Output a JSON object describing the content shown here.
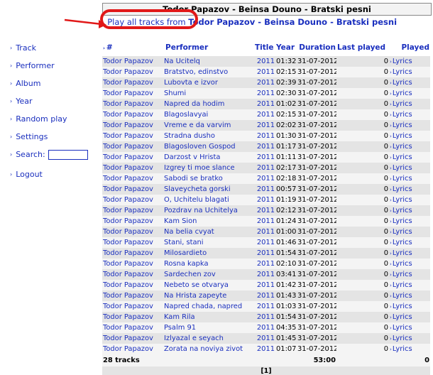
{
  "sidebar": {
    "items": [
      {
        "label": "Track"
      },
      {
        "label": "Performer"
      },
      {
        "label": "Album"
      },
      {
        "label": "Year"
      },
      {
        "label": "Random play"
      },
      {
        "label": "Settings"
      }
    ],
    "search_label": "Search:",
    "search_value": "",
    "logout": "Logout"
  },
  "header": {
    "title": "Todor Papazov - Beinsa Douno - Bratski pesni"
  },
  "play_all": {
    "label": "Play all tracks",
    "from": " from ",
    "artist": "Todor Papazov",
    "sep1": " - ",
    "album1": "Beinsa Douno",
    "sep2": " - ",
    "album2": "Bratski pesni"
  },
  "table": {
    "columns": {
      "num": "#",
      "performer": "Performer",
      "title": "Title",
      "year": "Year",
      "duration": "Duration",
      "last_played": "Last played",
      "played": "Played"
    },
    "rows": [
      {
        "performer": "Todor Papazov",
        "title": "Na Ucitelq",
        "year": "2011",
        "duration": "01:32",
        "date": "31-07-2012",
        "played": "0",
        "lyrics": "Lyrics"
      },
      {
        "performer": "Todor Papazov",
        "title": "Bratstvo, edinstvo",
        "year": "2011",
        "duration": "02:15",
        "date": "31-07-2012",
        "played": "0",
        "lyrics": "Lyrics"
      },
      {
        "performer": "Todor Papazov",
        "title": "Lubovta e izvor",
        "year": "2011",
        "duration": "02:39",
        "date": "31-07-2012",
        "played": "0",
        "lyrics": "Lyrics"
      },
      {
        "performer": "Todor Papazov",
        "title": "Shumi",
        "year": "2011",
        "duration": "02:30",
        "date": "31-07-2012",
        "played": "0",
        "lyrics": "Lyrics"
      },
      {
        "performer": "Todor Papazov",
        "title": "Napred da hodim",
        "year": "2011",
        "duration": "01:02",
        "date": "31-07-2012",
        "played": "0",
        "lyrics": "Lyrics"
      },
      {
        "performer": "Todor Papazov",
        "title": "Blagoslavyai",
        "year": "2011",
        "duration": "02:15",
        "date": "31-07-2012",
        "played": "0",
        "lyrics": "Lyrics"
      },
      {
        "performer": "Todor Papazov",
        "title": "Vreme e da varvim",
        "year": "2011",
        "duration": "02:02",
        "date": "31-07-2012",
        "played": "0",
        "lyrics": "Lyrics"
      },
      {
        "performer": "Todor Papazov",
        "title": "Stradna dusho",
        "year": "2011",
        "duration": "01:30",
        "date": "31-07-2012",
        "played": "0",
        "lyrics": "Lyrics"
      },
      {
        "performer": "Todor Papazov",
        "title": "Blagosloven Gospod",
        "year": "2011",
        "duration": "01:17",
        "date": "31-07-2012",
        "played": "0",
        "lyrics": "Lyrics"
      },
      {
        "performer": "Todor Papazov",
        "title": "Darzost v Hrista",
        "year": "2011",
        "duration": "01:11",
        "date": "31-07-2012",
        "played": "0",
        "lyrics": "Lyrics"
      },
      {
        "performer": "Todor Papazov",
        "title": "Izgrey ti moe slance",
        "year": "2011",
        "duration": "02:17",
        "date": "31-07-2012",
        "played": "0",
        "lyrics": "Lyrics"
      },
      {
        "performer": "Todor Papazov",
        "title": "Sabodi se bratko",
        "year": "2011",
        "duration": "02:18",
        "date": "31-07-2012",
        "played": "0",
        "lyrics": "Lyrics"
      },
      {
        "performer": "Todor Papazov",
        "title": "Slaveycheta gorski",
        "year": "2011",
        "duration": "00:57",
        "date": "31-07-2012",
        "played": "0",
        "lyrics": "Lyrics"
      },
      {
        "performer": "Todor Papazov",
        "title": "O, Uchitelu blagati",
        "year": "2011",
        "duration": "01:19",
        "date": "31-07-2012",
        "played": "0",
        "lyrics": "Lyrics"
      },
      {
        "performer": "Todor Papazov",
        "title": "Pozdrav na Uchitelya",
        "year": "2011",
        "duration": "02:12",
        "date": "31-07-2012",
        "played": "0",
        "lyrics": "Lyrics"
      },
      {
        "performer": "Todor Papazov",
        "title": "Kam Sion",
        "year": "2011",
        "duration": "01:24",
        "date": "31-07-2012",
        "played": "0",
        "lyrics": "Lyrics"
      },
      {
        "performer": "Todor Papazov",
        "title": "Na belia cvyat",
        "year": "2011",
        "duration": "01:00",
        "date": "31-07-2012",
        "played": "0",
        "lyrics": "Lyrics"
      },
      {
        "performer": "Todor Papazov",
        "title": "Stani, stani",
        "year": "2011",
        "duration": "01:46",
        "date": "31-07-2012",
        "played": "0",
        "lyrics": "Lyrics"
      },
      {
        "performer": "Todor Papazov",
        "title": "Milosardieto",
        "year": "2011",
        "duration": "01:54",
        "date": "31-07-2012",
        "played": "0",
        "lyrics": "Lyrics"
      },
      {
        "performer": "Todor Papazov",
        "title": "Rosna kapka",
        "year": "2011",
        "duration": "02:10",
        "date": "31-07-2012",
        "played": "0",
        "lyrics": "Lyrics"
      },
      {
        "performer": "Todor Papazov",
        "title": "Sardechen zov",
        "year": "2011",
        "duration": "03:41",
        "date": "31-07-2012",
        "played": "0",
        "lyrics": "Lyrics"
      },
      {
        "performer": "Todor Papazov",
        "title": "Nebeto se otvarya",
        "year": "2011",
        "duration": "01:42",
        "date": "31-07-2012",
        "played": "0",
        "lyrics": "Lyrics"
      },
      {
        "performer": "Todor Papazov",
        "title": "Na Hrista zapeyte",
        "year": "2011",
        "duration": "01:43",
        "date": "31-07-2012",
        "played": "0",
        "lyrics": "Lyrics"
      },
      {
        "performer": "Todor Papazov",
        "title": "Napred chada, napred",
        "year": "2011",
        "duration": "01:03",
        "date": "31-07-2012",
        "played": "0",
        "lyrics": "Lyrics"
      },
      {
        "performer": "Todor Papazov",
        "title": "Kam Rila",
        "year": "2011",
        "duration": "01:54",
        "date": "31-07-2012",
        "played": "0",
        "lyrics": "Lyrics"
      },
      {
        "performer": "Todor Papazov",
        "title": "Psalm 91",
        "year": "2011",
        "duration": "04:35",
        "date": "31-07-2012",
        "played": "0",
        "lyrics": "Lyrics"
      },
      {
        "performer": "Todor Papazov",
        "title": "Izlyazal e seyach",
        "year": "2011",
        "duration": "01:45",
        "date": "31-07-2012",
        "played": "0",
        "lyrics": "Lyrics"
      },
      {
        "performer": "Todor Papazov",
        "title": "Zorata na noviya zivot",
        "year": "2011",
        "duration": "01:07",
        "date": "31-07-2012",
        "played": "0",
        "lyrics": "Lyrics"
      }
    ],
    "footer": {
      "count": "28 tracks",
      "total_duration": "53:00",
      "total_played": "0"
    },
    "pager": "[1]"
  },
  "colors": {
    "link": "#1a2fbe",
    "row_odd": "#e4e4e4",
    "row_even": "#f4f4f4",
    "highlight": "#e11818"
  }
}
